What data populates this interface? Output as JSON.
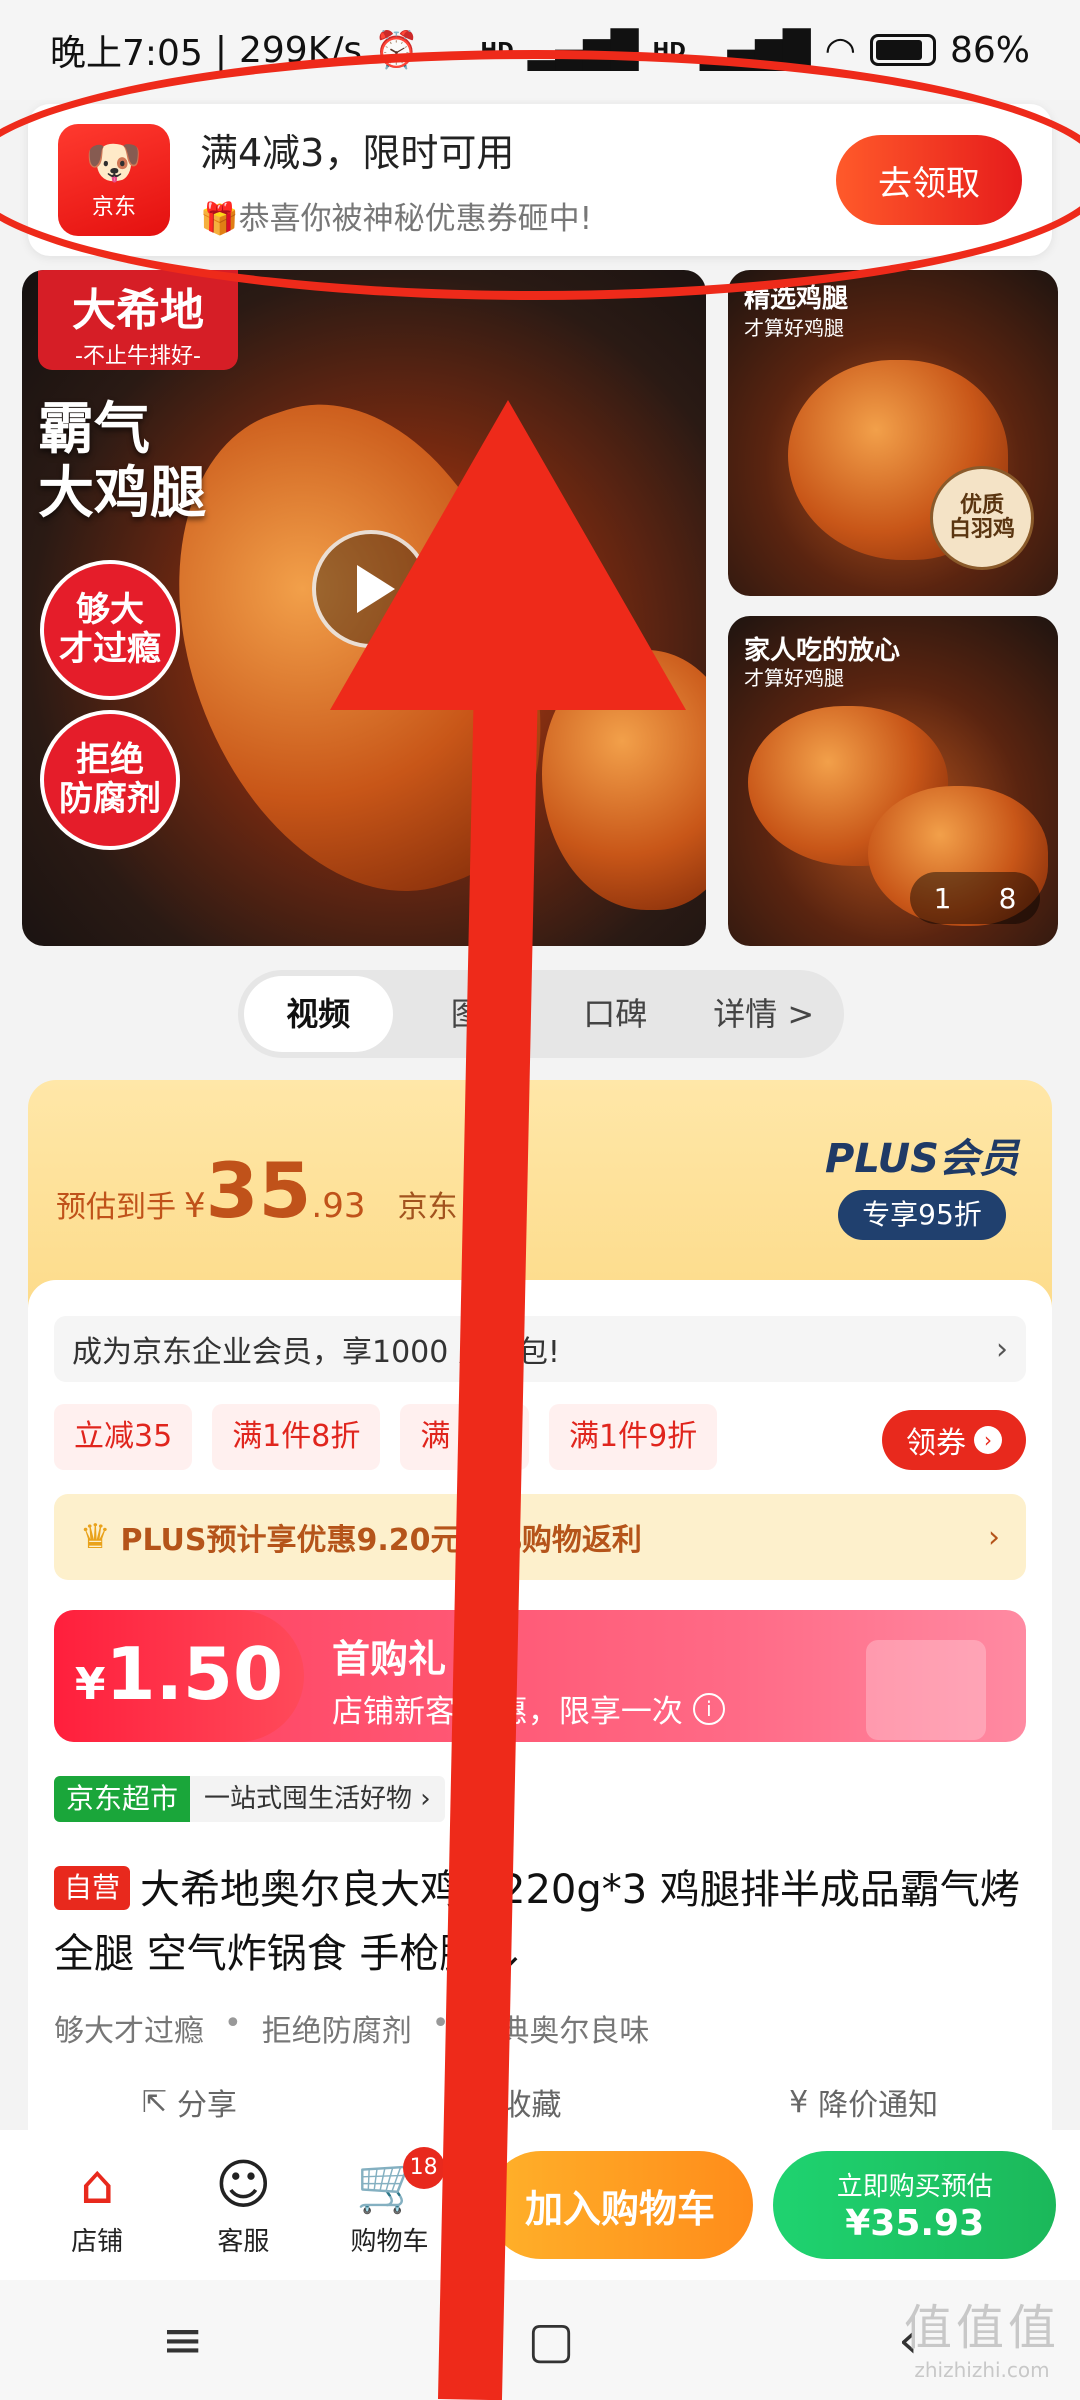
{
  "status_bar": {
    "time": "晚上7:05",
    "speed": "299K/s",
    "network1": "HD",
    "network2": "HD",
    "battery": "86%",
    "battery_level": 0.86
  },
  "notification": {
    "app_name": "京东",
    "title": "满4减3，限时可用",
    "subtitle": "🎁恭喜你被神秘优惠券砸中!",
    "button": "去领取"
  },
  "gallery": {
    "brand": "大希地",
    "brand_slogan": "-不止牛排好-",
    "headline_1": "霸气",
    "headline_2": "大鸡腿",
    "badge_1": "够大\n才过瘾",
    "badge_2": "拒绝\n防腐剂",
    "thumb1_title": "精选鸡腿",
    "thumb1_sub": "才算好鸡腿",
    "thumb1_seal": "优质\n白羽鸡",
    "thumb2_title": "家人吃的放心",
    "thumb2_sub": "才算好鸡腿",
    "counter_current": "1",
    "counter_total": "8"
  },
  "tabs": [
    {
      "label": "视频"
    },
    {
      "label": "图"
    },
    {
      "label": "口碑"
    },
    {
      "label": "详情 >"
    }
  ],
  "price": {
    "label": "预估到手",
    "symbol": "¥",
    "integer": "35",
    "decimal": ".93",
    "jd_price": "京东 .90›",
    "plus_title": "PLUS会员",
    "plus_discount": "专享95折"
  },
  "enterprise": {
    "text": "成为京东企业会员，享1000 人礼包!",
    "chevron": "›"
  },
  "promo_tags": [
    "立减35",
    "满1件8折",
    "满 0折",
    "满1件9折"
  ],
  "coupon_button": "领券",
  "plus_rebate": {
    "text": "PLUS预计享优惠9.20元 2%购物返利",
    "chevron": "›"
  },
  "first_buy": {
    "symbol": "¥",
    "amount": "1.50",
    "title": "首购礼",
    "subtitle": "店铺新客 优惠，限享一次"
  },
  "store": {
    "badge": "京东超市",
    "slogan": "一站式囤生活好物 ›"
  },
  "product": {
    "badge": "自营",
    "title": "大希地奥尔良大鸡腿220g*3 鸡腿排半成品霸气烤全腿 空气炸锅食 手枪腿 ⌄",
    "features": [
      "够大才过瘾",
      "拒绝防腐剂",
      "经典奥尔良味"
    ]
  },
  "actions": {
    "share": "分享",
    "favorite": "收藏",
    "price_alert": "降价通知"
  },
  "bottom_bar": {
    "store": "店铺",
    "service": "客服",
    "cart": "购物车",
    "cart_count": "18",
    "add_to_cart": "加入购物车",
    "buy_line1": "立即购买预估",
    "buy_line2": "¥35.93"
  },
  "system_nav": {
    "menu": "≡",
    "home": "▢",
    "back": "‹"
  },
  "watermark": {
    "line1": "值值值",
    "line2": "zhizhizhi.com"
  },
  "colors": {
    "jd_red": "#e8291d",
    "annotation_red": "#ee2a1a",
    "buy_green": "#1bb85a",
    "cart_orange": "#ff8c1a"
  }
}
